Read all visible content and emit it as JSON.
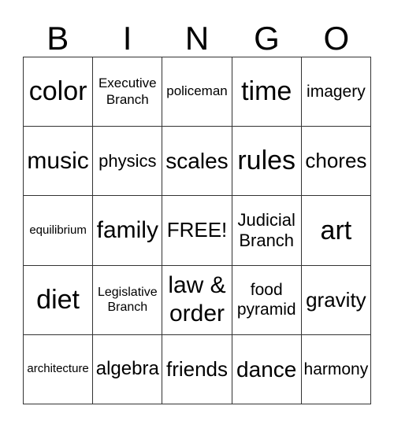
{
  "header": [
    "B",
    "I",
    "N",
    "G",
    "O"
  ],
  "cells": [
    "color",
    "Executive\nBranch",
    "policeman",
    "time",
    "imagery",
    "music",
    "physics",
    "scales",
    "rules",
    "chores",
    "equilibrium",
    "family",
    "FREE!",
    "Judicial\nBranch",
    "art",
    "diet",
    "Legislative\nBranch",
    "law &\norder",
    "food\npyramid",
    "gravity",
    "architecture",
    "algebra",
    "friends",
    "dance",
    "harmony"
  ]
}
